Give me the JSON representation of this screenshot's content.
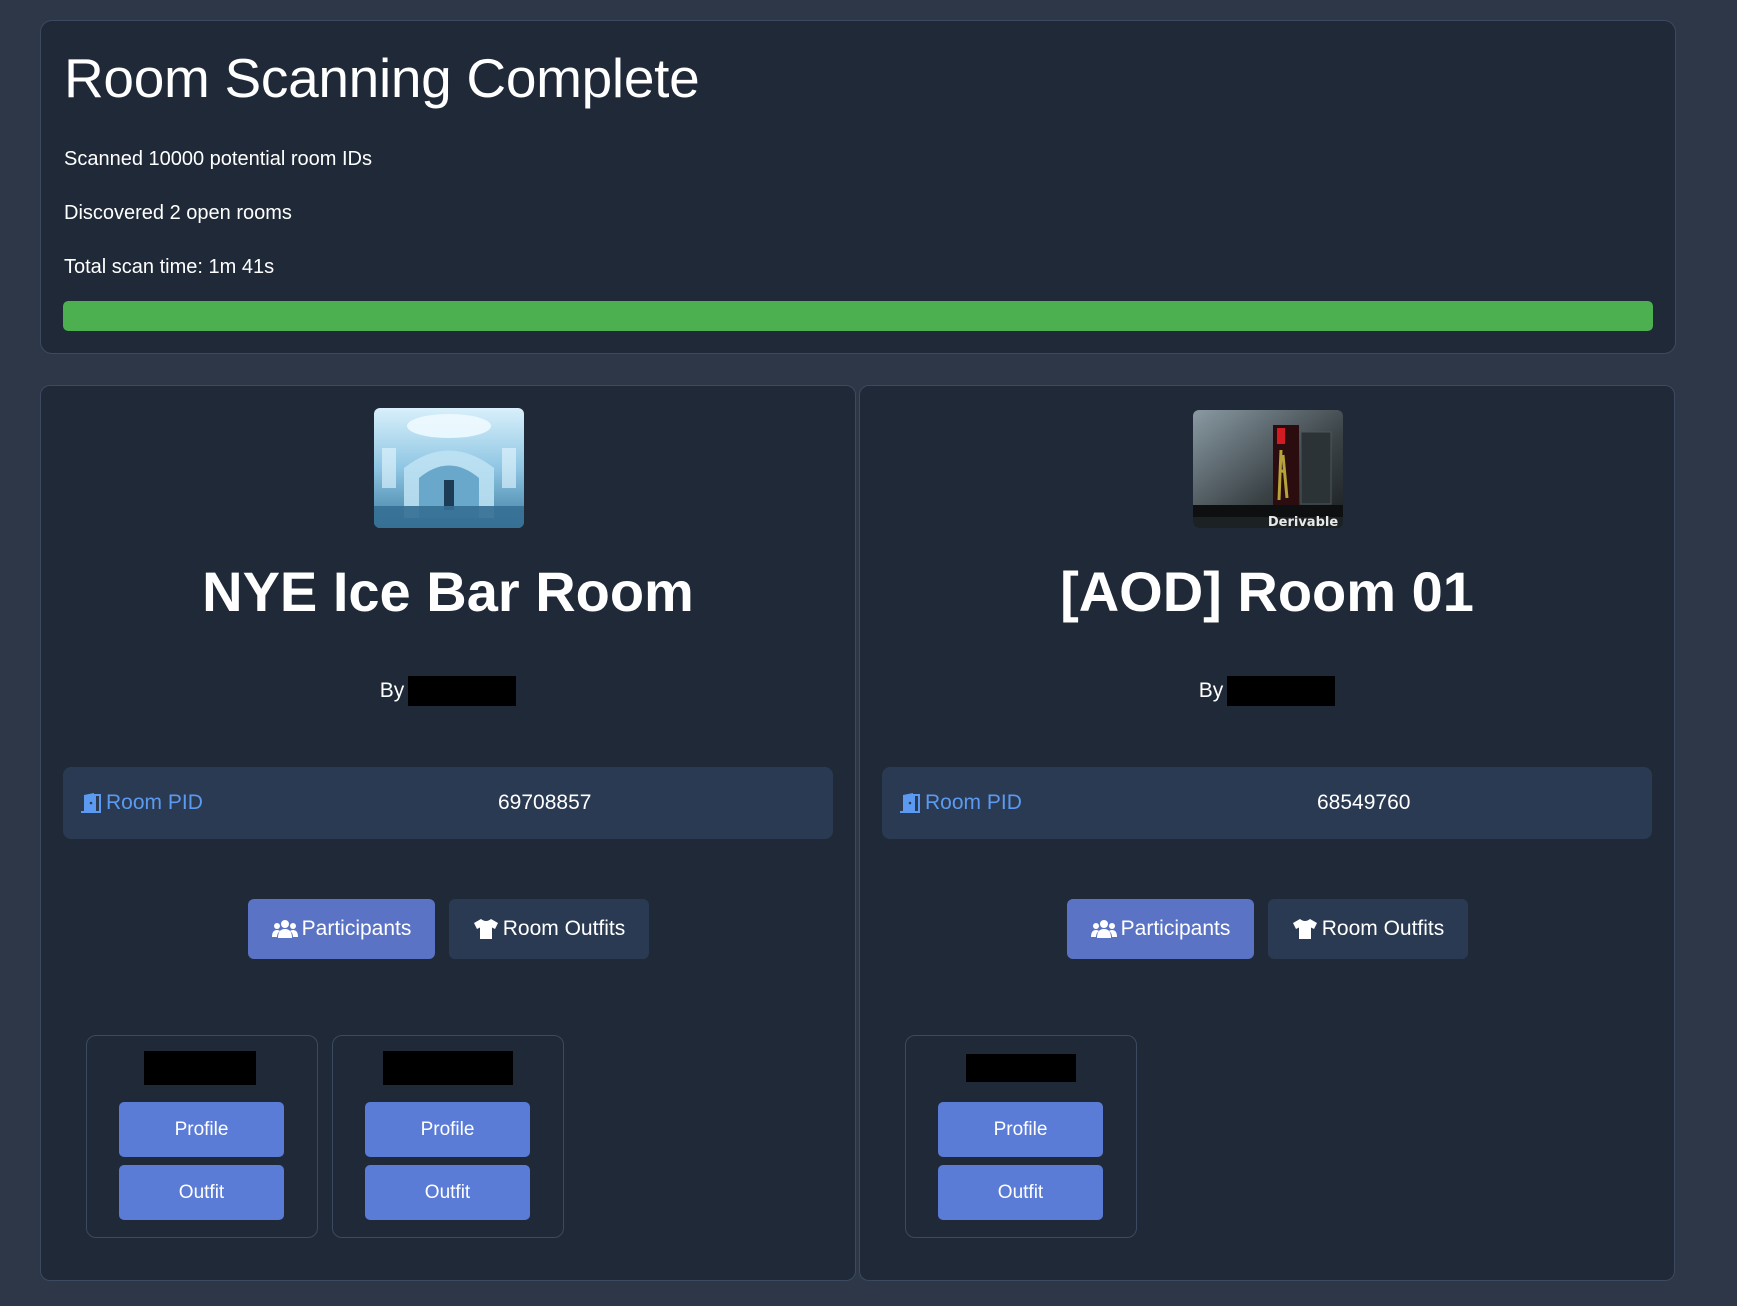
{
  "summary": {
    "title": "Room Scanning Complete",
    "scanned": "Scanned 10000 potential room IDs",
    "discovered": "Discovered 2 open rooms",
    "total_time": "Total scan time: 1m 41s",
    "progress_fraction": 1.0,
    "progress_color": "#4caf50"
  },
  "rooms": [
    {
      "title": "NYE Ice Bar Room",
      "by_label": "By",
      "pid_label": "Room PID",
      "pid_value": "69708857",
      "participants_label": "Participants",
      "outfits_label": "Room Outfits",
      "participants": [
        {
          "profile_label": "Profile",
          "outfit_label": "Outfit"
        },
        {
          "profile_label": "Profile",
          "outfit_label": "Outfit"
        }
      ]
    },
    {
      "title": "[AOD] Room 01",
      "by_label": "By",
      "pid_label": "Room PID",
      "pid_value": "68549760",
      "thumb_caption": "Derivable",
      "participants_label": "Participants",
      "outfits_label": "Room Outfits",
      "participants": [
        {
          "profile_label": "Profile",
          "outfit_label": "Outfit"
        }
      ]
    }
  ],
  "colors": {
    "accent": "#5a73c4",
    "pid_link": "#5b9af0",
    "card_bg": "#1f2937",
    "page_bg": "#2d3748"
  }
}
